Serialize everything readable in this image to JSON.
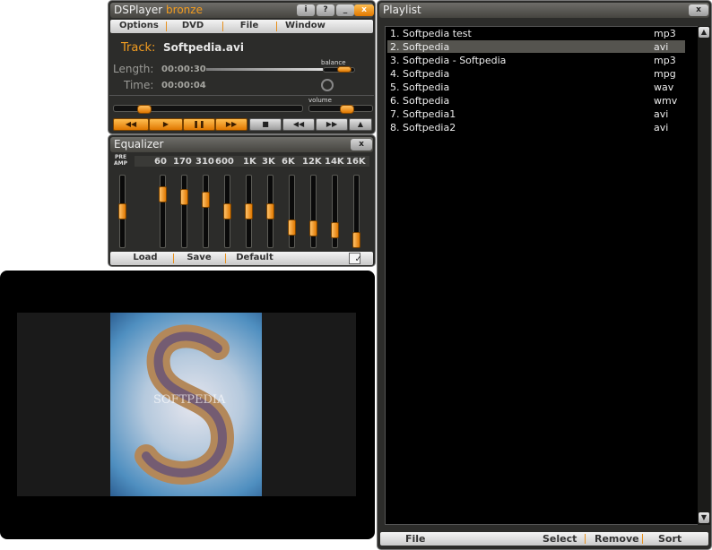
{
  "player": {
    "title": "DSPlayer",
    "edition": "bronze",
    "buttons": {
      "info": "i",
      "help": "?",
      "minimize": "_",
      "close": "x"
    },
    "menu": [
      "Options",
      "DVD",
      "File",
      "Window"
    ],
    "track_label": "Track:",
    "track_value": "Softpedia.avi",
    "length_label": "Length:",
    "length_value": "00:00:30",
    "time_label": "Time:",
    "time_value": "00:00:04",
    "balance_label": "balance",
    "volume_label": "volume",
    "seek_progress": 0.13,
    "volume_level": 0.5
  },
  "equalizer": {
    "title": "Equalizer",
    "close": "x",
    "preamp_label_top": "PRE",
    "preamp_label_bottom": "AMP",
    "bands": [
      "60",
      "170",
      "310",
      "600",
      "1K",
      "3K",
      "6K",
      "12K",
      "14K",
      "16K"
    ],
    "preamp_level": 0.5,
    "band_levels": [
      0.74,
      0.7,
      0.66,
      0.5,
      0.5,
      0.5,
      0.28,
      0.26,
      0.24,
      0.1
    ],
    "footer": {
      "load": "Load",
      "save": "Save",
      "default": "Default"
    }
  },
  "playlist": {
    "title": "Playlist",
    "close": "x",
    "items": [
      {
        "name": "1. Softpedia test",
        "ext": "mp3"
      },
      {
        "name": "2. Softpedia",
        "ext": "avi"
      },
      {
        "name": "3. Softpedia - Softpedia",
        "ext": "mp3"
      },
      {
        "name": "4. Softpedia",
        "ext": "mpg"
      },
      {
        "name": "5. Softpedia",
        "ext": "wav"
      },
      {
        "name": "6. Softpedia",
        "ext": "wmv"
      },
      {
        "name": "7. Softpedia1",
        "ext": "avi"
      },
      {
        "name": "8. Softpedia2",
        "ext": "avi"
      }
    ],
    "selected_index": 1,
    "footer": {
      "file": "File",
      "select": "Select",
      "remove": "Remove",
      "sort": "Sort"
    }
  },
  "video": {
    "watermark": "SOFTPEDIA"
  },
  "colors": {
    "accent": "#f29c20",
    "panel": "#2c2c2a"
  }
}
